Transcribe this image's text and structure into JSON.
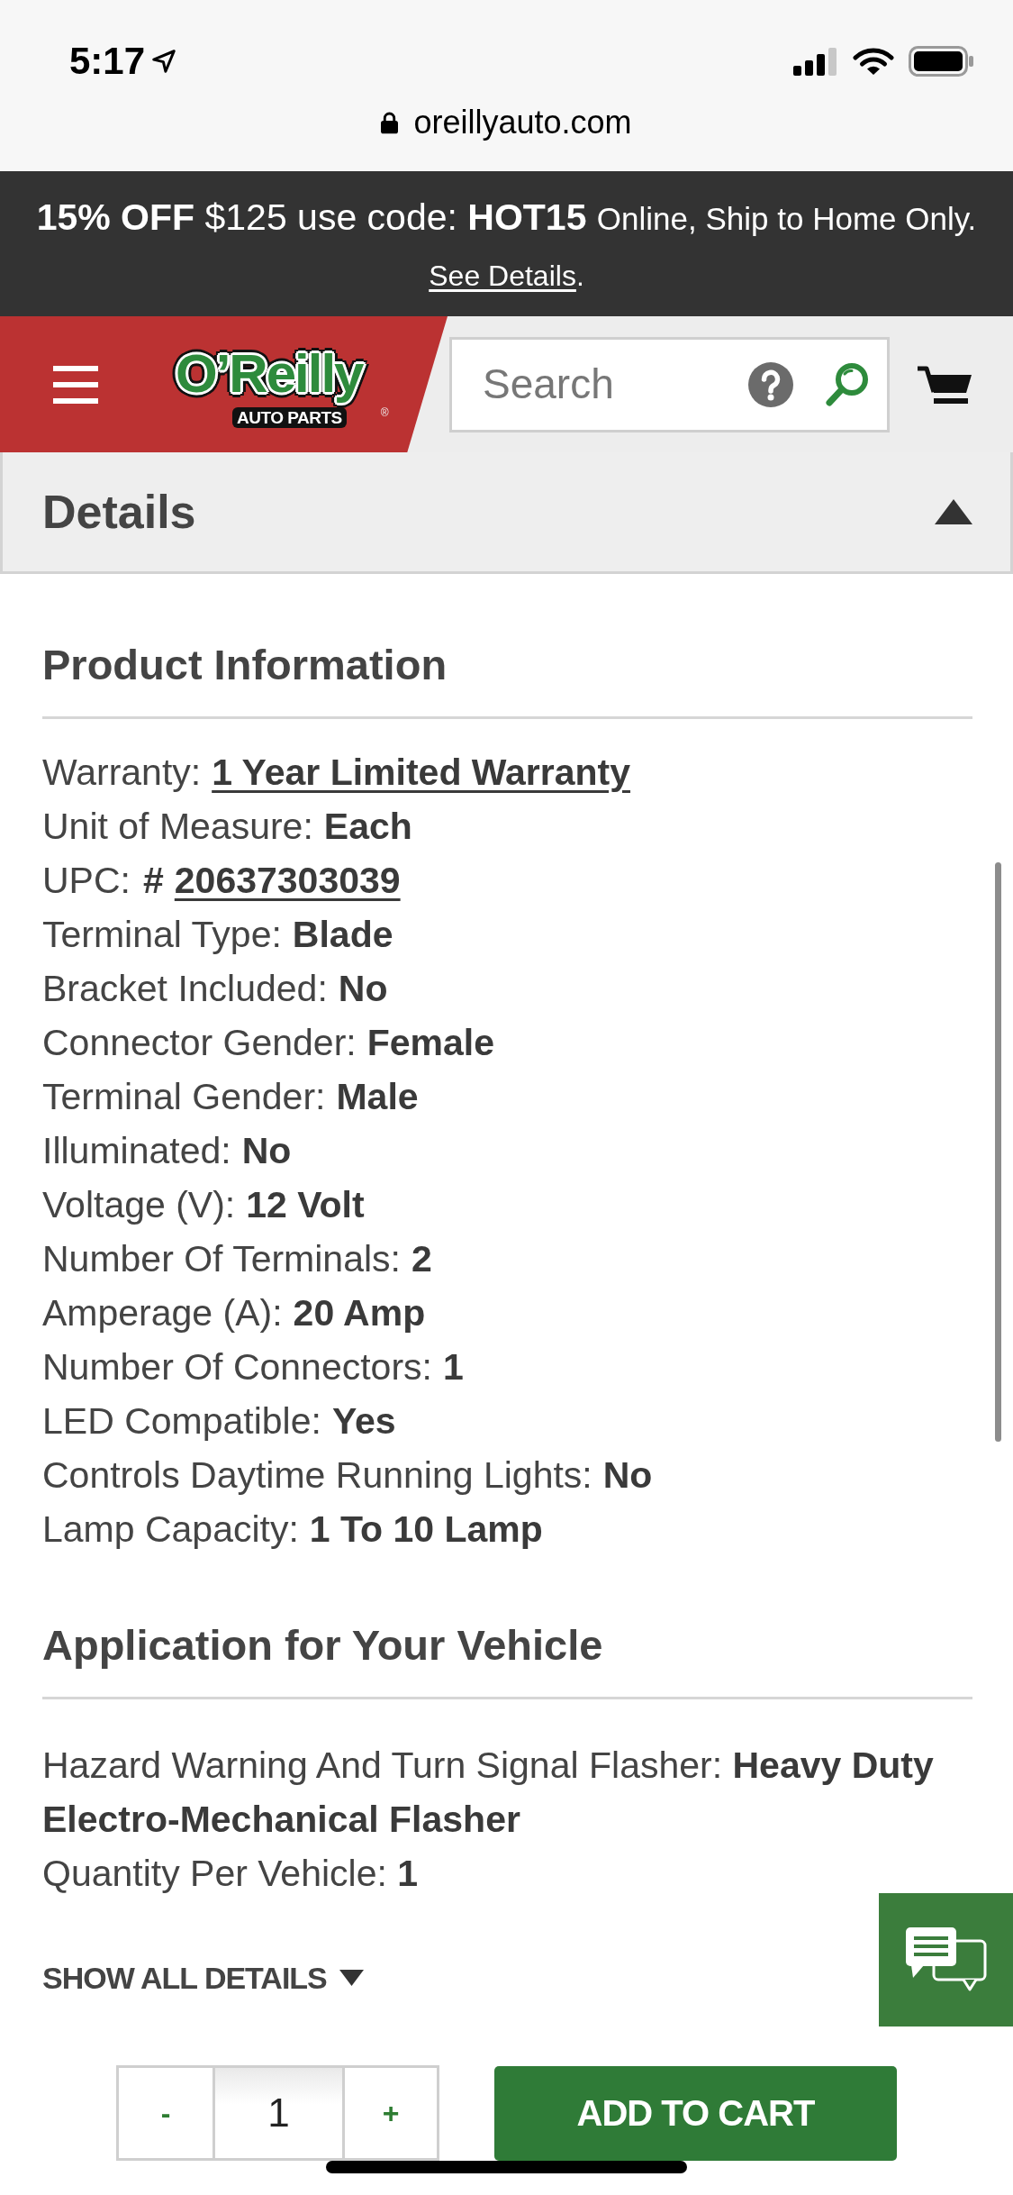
{
  "status_bar": {
    "time": "5:17",
    "url": "oreillyauto.com"
  },
  "promo_banner": {
    "text": "**15% OFF** $125 use code: **HOT15**",
    "note": "Online, Ship to Home Only.",
    "link": "See Details",
    "after_link": "."
  },
  "header": {
    "logo": {
      "wordmark": "O’Reilly",
      "tagline": "AUTO PARTS",
      "mark": "®"
    },
    "search": {
      "placeholder": "Search"
    }
  },
  "details_panel": {
    "title": "Details",
    "expanded": true
  },
  "product_information": {
    "title": "Product Information",
    "rows": [
      {
        "label": "Warranty:",
        "value": "1 Year Limited Warranty",
        "link": true
      },
      {
        "label": "Unit of Measure:",
        "value": "Each",
        "link": false
      },
      {
        "label": "UPC:",
        "prefix": "#",
        "value": "20637303039",
        "link": true
      },
      {
        "label": "Terminal Type:",
        "value": "Blade",
        "link": false
      },
      {
        "label": "Bracket Included:",
        "value": "No",
        "link": false
      },
      {
        "label": "Connector Gender:",
        "value": "Female",
        "link": false
      },
      {
        "label": "Terminal Gender:",
        "value": "Male",
        "link": false
      },
      {
        "label": "Illuminated:",
        "value": "No",
        "link": false
      },
      {
        "label": "Voltage (V):",
        "value": "12 Volt",
        "link": false
      },
      {
        "label": "Number Of Terminals:",
        "value": "2",
        "link": false
      },
      {
        "label": "Amperage (A):",
        "value": "20 Amp",
        "link": false
      },
      {
        "label": "Number Of Connectors:",
        "value": "1",
        "link": false
      },
      {
        "label": "LED Compatible:",
        "value": "Yes",
        "link": false
      },
      {
        "label": "Controls Daytime Running Lights:",
        "value": "No",
        "link": false
      },
      {
        "label": "Lamp Capacity:",
        "value": "1 To 10 Lamp",
        "link": false
      }
    ]
  },
  "application": {
    "title": "Application for Your Vehicle",
    "rows": [
      {
        "label": "Hazard Warning And Turn Signal Flasher:",
        "value": "Heavy Duty Electro-Mechanical Flasher"
      },
      {
        "label": "Quantity Per Vehicle:",
        "value": "1"
      }
    ]
  },
  "show_all_details": "SHOW ALL DETAILS",
  "quantity": {
    "decrement": "-",
    "value": "1",
    "increment": "+"
  },
  "add_to_cart": "ADD TO CART"
}
